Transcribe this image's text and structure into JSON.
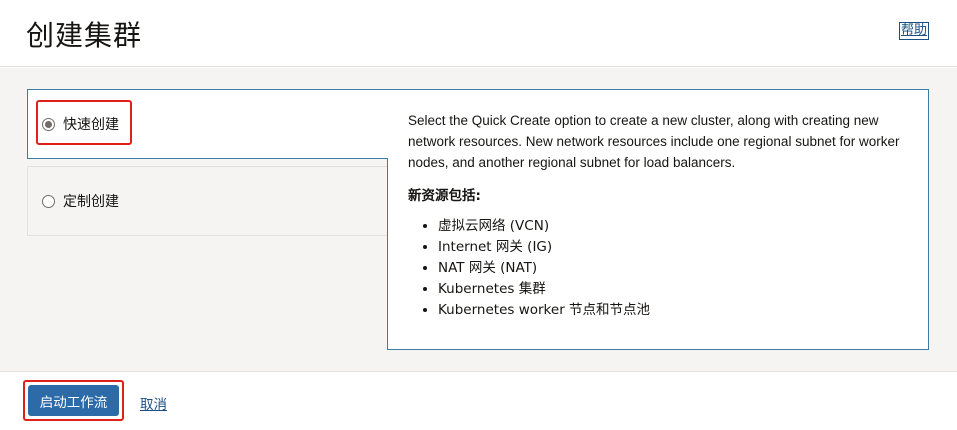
{
  "header": {
    "title": "创建集群",
    "help_label": "帮助"
  },
  "options": [
    {
      "label": "快速创建",
      "selected": true
    },
    {
      "label": "定制创建",
      "selected": false
    }
  ],
  "panel": {
    "description": "Select the Quick Create option to create a new cluster, along with creating new network resources. New network resources include one regional subnet for worker nodes, and another regional subnet for load balancers.",
    "subtitle": "新资源包括:",
    "resources": [
      "虚拟云网络 (VCN)",
      "Internet 网关 (IG)",
      "NAT 网关 (NAT)",
      "Kubernetes 集群",
      "Kubernetes worker 节点和节点池"
    ]
  },
  "footer": {
    "start_label": "启动工作流",
    "cancel_label": "取消"
  },
  "colors": {
    "accent": "#2c6aa8",
    "panel_border": "#3c7ea3",
    "highlight": "#e0201b",
    "background": "#f5f4f2"
  }
}
